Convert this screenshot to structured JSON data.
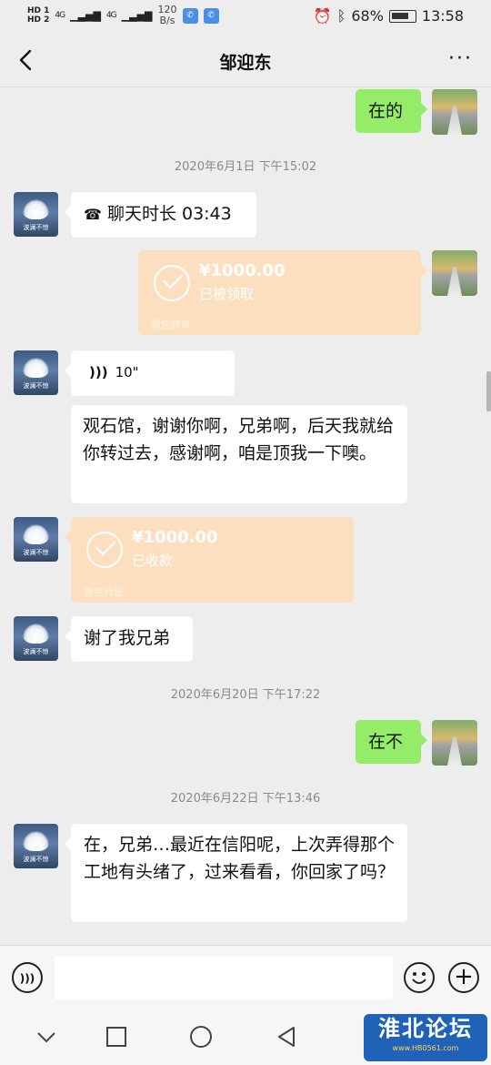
{
  "status_bar": {
    "hd1": "HD 1",
    "hd2": "HD 2",
    "signal1": "4G",
    "signal2": "4G",
    "speed_value": "120",
    "speed_unit": "B/s",
    "battery": "68%",
    "time": "13:58"
  },
  "header": {
    "title": "邹迎东",
    "more": "···"
  },
  "avatar_caption": "波澜不惊",
  "messages": {
    "m1": {
      "text": "在的"
    },
    "ts1": "2020年6月1日 下午15:02",
    "m2": {
      "call_label": "聊天时长 03:43"
    },
    "m3": {
      "amount": "¥1000.00",
      "status": "已被领取",
      "source": "微信转账"
    },
    "m4": {
      "voice_duration": "10\""
    },
    "m5": {
      "text": "观石馆，谢谢你啊，兄弟啊，后天我就给你转过去，感谢啊，咱是顶我一下噢。"
    },
    "m6": {
      "amount": "¥1000.00",
      "status": "已收款",
      "source": "微信转账"
    },
    "m7": {
      "text": "谢了我兄弟"
    },
    "ts2": "2020年6月20日 下午17:22",
    "m8": {
      "text": "在不"
    },
    "ts3": "2020年6月22日 下午13:46",
    "m9": {
      "text": "在，兄弟…最近在信阳呢，上次弄得那个工地有头绪了，过来看看，你回家了吗？"
    }
  },
  "input_bar": {
    "voice_icon": "voice-toggle-icon",
    "emoji_icon": "emoji-icon",
    "plus_icon": "plus-icon",
    "plus_glyph": "+"
  },
  "watermark": {
    "title": "淮北论坛",
    "url": "www.HB0561.com"
  },
  "colors": {
    "background": "#ededed",
    "sent_bubble": "#95ec69",
    "received_bubble": "#ffffff",
    "transfer_card": "#fcdfbf"
  }
}
